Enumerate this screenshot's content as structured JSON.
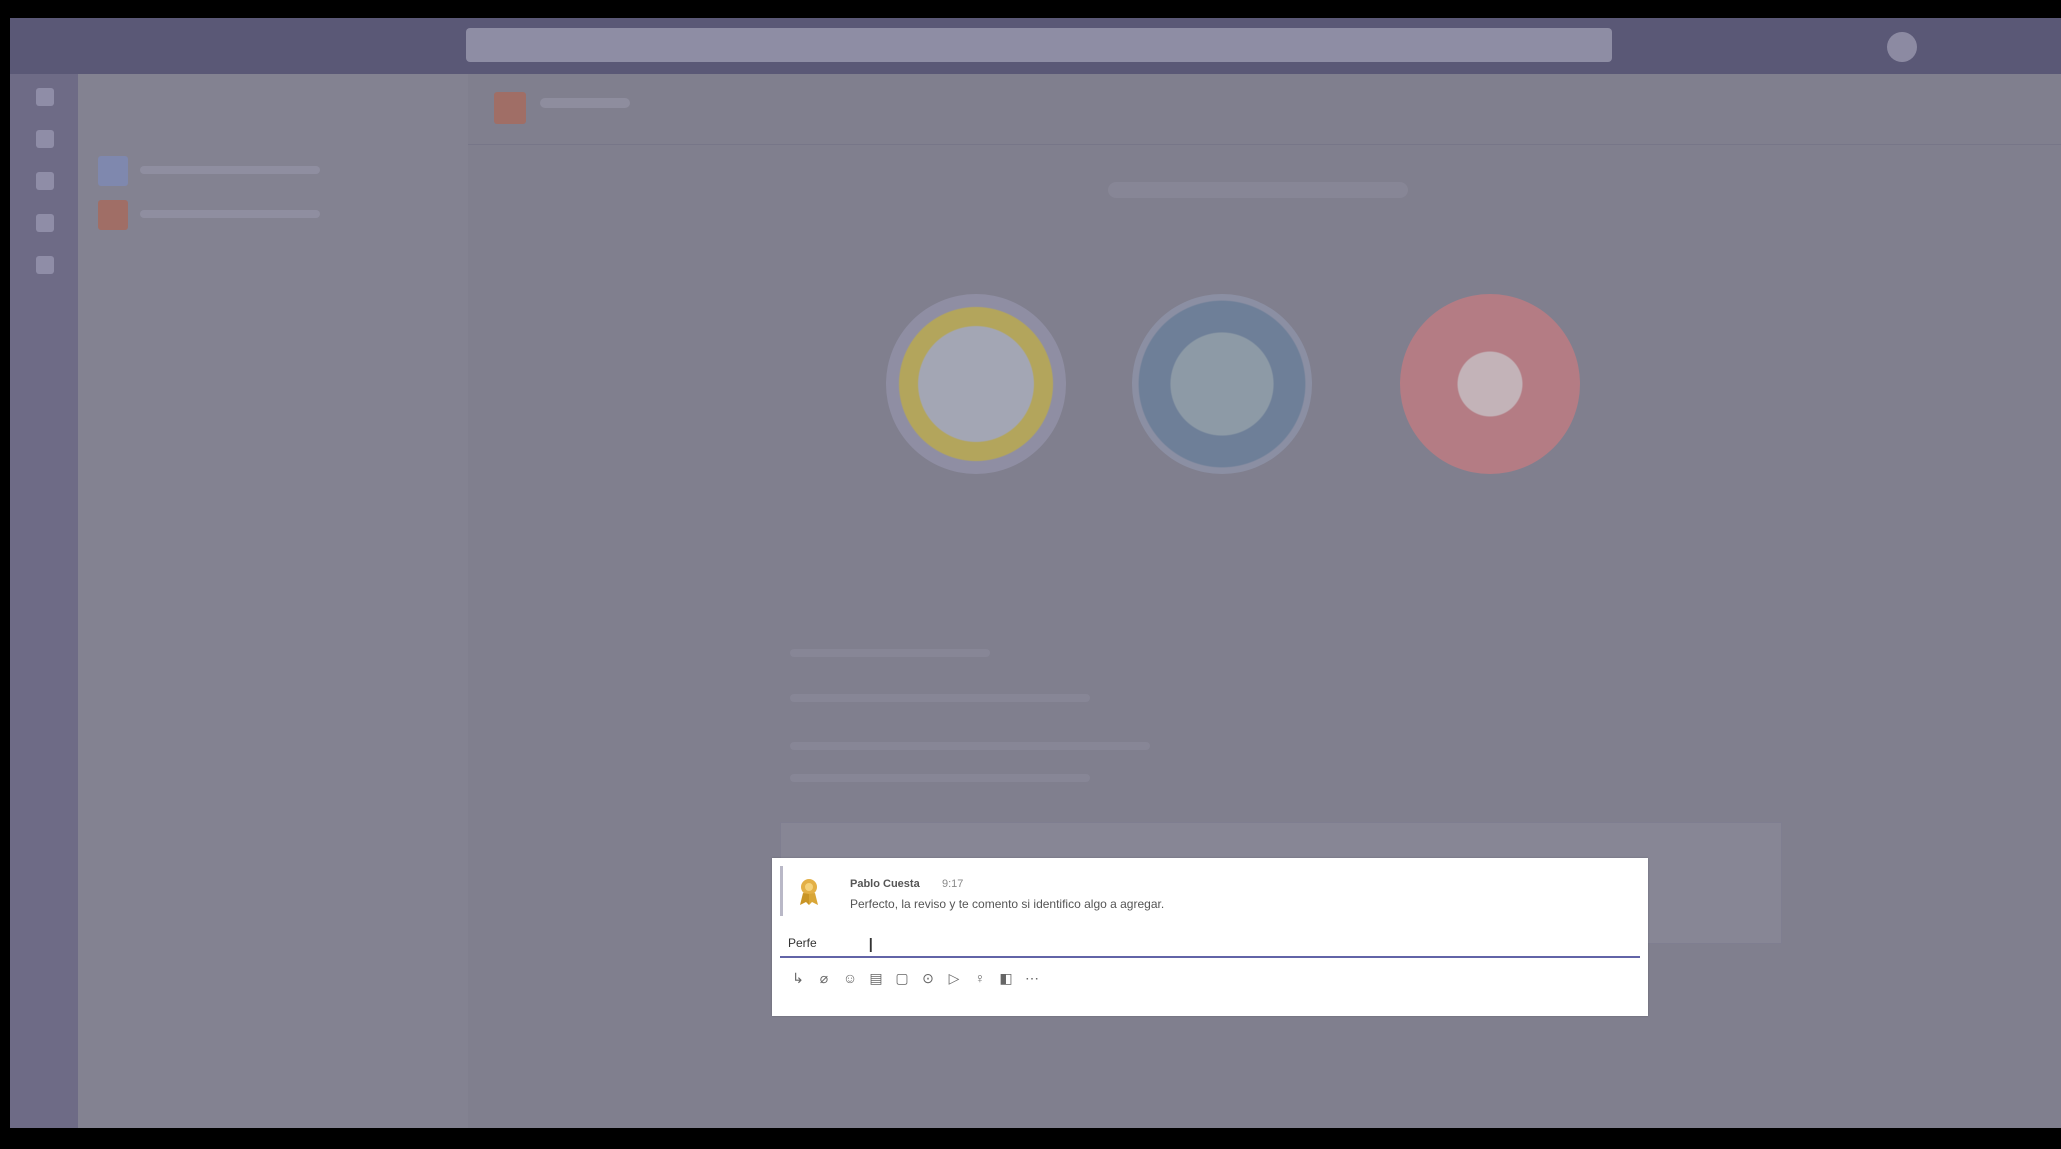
{
  "compose_popup": {
    "message": {
      "author": "Pablo Cuesta",
      "time": "9:17",
      "text": "Perfecto, la reviso y te comento si identifico algo a agregar."
    },
    "reply_input_value": "Perfe",
    "toolbar_icons": [
      "format-icon",
      "attach-icon",
      "emoji-icon",
      "gif-icon",
      "sticker-icon",
      "meet-icon",
      "schedule-icon",
      "praise-icon",
      "stream-icon",
      "more-icon"
    ]
  },
  "colors": {
    "overlay_background": "#7a7986",
    "accent": "#6264a7",
    "popup_background": "#ffffff"
  }
}
